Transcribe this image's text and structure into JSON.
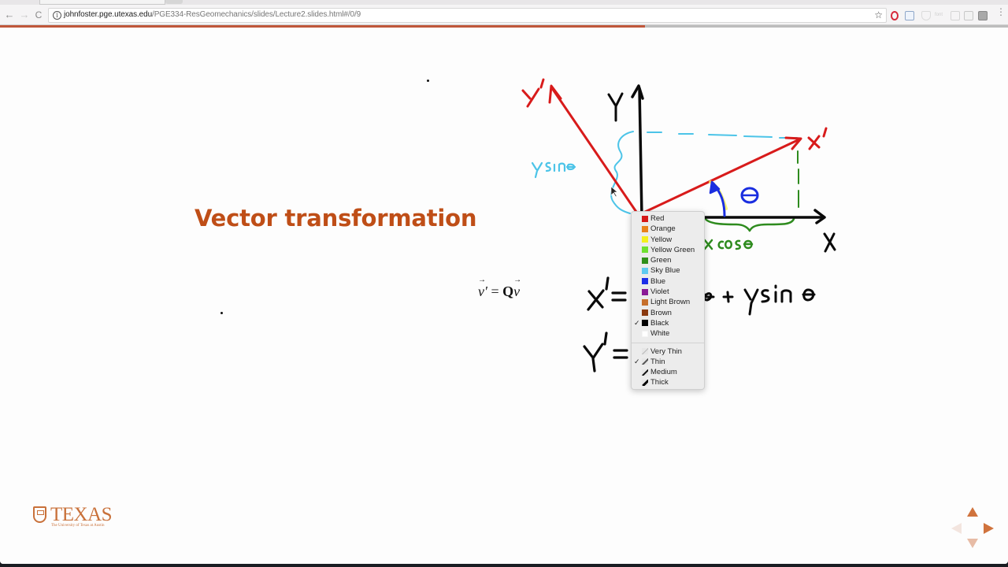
{
  "browser": {
    "url_host": "johnfoster.pge.utexas.edu",
    "url_path": "/PGE334-ResGeomechanics/slides/Lecture2.slides.html#/0/9",
    "back_icon": "←",
    "forward_icon": "→",
    "reload_icon": "C",
    "info_icon": "i",
    "star_icon": "☆",
    "menu_icon": "⋮",
    "ext_font_label": "font"
  },
  "slide": {
    "title": "Vector transformation",
    "equation": {
      "lhs_vec": "v",
      "prime": "′",
      "equals": " = ",
      "matrix": "Q",
      "rhs_vec": "v"
    },
    "presentation_progress_percent": 64,
    "logo": {
      "wordmark": "TEXAS",
      "subtitle": "The University of Texas at Austin"
    },
    "navigation": {
      "up_enabled": true,
      "right_enabled": true,
      "left_enabled": false,
      "down_enabled": false
    }
  },
  "annotations": {
    "axis_labels": {
      "x": "X",
      "y": "Y",
      "x_prime": "x'",
      "y_prime": "y'"
    },
    "theta": "θ",
    "y_sin_label": "ysinθ",
    "x_cos_label": "x cosθ",
    "eq_x_prime_lhs": "x'=",
    "eq_x_prime_rhs": "θ + y sin θ",
    "eq_y_prime_lhs": "y'=",
    "colors": {
      "red": "#d81b1b",
      "black": "#0a0a0a",
      "sky_blue": "#4cc4e8",
      "blue": "#1a2ee0",
      "green": "#2e8b1e",
      "yellow": "#f3ef5a"
    }
  },
  "context_menu": {
    "colors": [
      {
        "label": "Red",
        "swatch": "#d51717",
        "checked": false
      },
      {
        "label": "Orange",
        "swatch": "#e8821c",
        "checked": false
      },
      {
        "label": "Yellow",
        "swatch": "#f4f01e",
        "checked": false
      },
      {
        "label": "Yellow Green",
        "swatch": "#6fe030",
        "checked": false
      },
      {
        "label": "Green",
        "swatch": "#2f8f1a",
        "checked": false
      },
      {
        "label": "Sky Blue",
        "swatch": "#5fcaf0",
        "checked": false
      },
      {
        "label": "Blue",
        "swatch": "#1d2ee8",
        "checked": false
      },
      {
        "label": "Violet",
        "swatch": "#8a1a96",
        "checked": false
      },
      {
        "label": "Light Brown",
        "swatch": "#c66f2c",
        "checked": false
      },
      {
        "label": "Brown",
        "swatch": "#8a3a10",
        "checked": false
      },
      {
        "label": "Black",
        "swatch": "#000000",
        "checked": true
      },
      {
        "label": "White",
        "swatch": "#ffffff",
        "checked": false
      }
    ],
    "widths": [
      {
        "label": "Very Thin",
        "swatch": "#b8b8b8",
        "checked": false
      },
      {
        "label": "Thin",
        "swatch": "#555555",
        "checked": true
      },
      {
        "label": "Medium",
        "swatch": "#111111",
        "checked": false
      },
      {
        "label": "Thick",
        "swatch": "#000000",
        "checked": false
      }
    ],
    "check_mark": "✓"
  }
}
